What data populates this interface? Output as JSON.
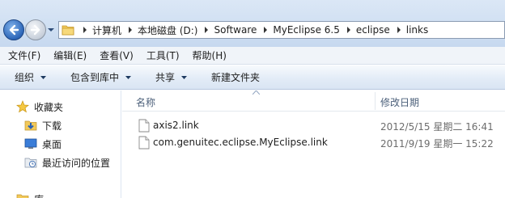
{
  "address_bar": {
    "breadcrumbs": [
      "计算机",
      "本地磁盘 (D:)",
      "Software",
      "MyEclipse 6.5",
      "eclipse",
      "links"
    ],
    "separator_icon": "chevron-right-icon",
    "folder_icon": "folder-icon"
  },
  "menu": {
    "items": [
      "文件(F)",
      "编辑(E)",
      "查看(V)",
      "工具(T)",
      "帮助(H)"
    ]
  },
  "commands": {
    "organize": "组织",
    "include_library": "包含到库中",
    "share": "共享",
    "new_folder": "新建文件夹"
  },
  "nav_pane": {
    "items": [
      {
        "label": "收藏夹",
        "icon": "star-icon"
      },
      {
        "label": "下载",
        "icon": "downloads-folder-icon"
      },
      {
        "label": "桌面",
        "icon": "desktop-icon"
      },
      {
        "label": "最近访问的位置",
        "icon": "recent-places-icon"
      },
      {
        "label": "库",
        "icon": "library-icon"
      }
    ]
  },
  "file_list": {
    "columns": {
      "name": "名称",
      "date_modified": "修改日期"
    },
    "rows": [
      {
        "name": "axis2.link",
        "date": "2012/5/15 星期二 16:41",
        "icon": "file-icon"
      },
      {
        "name": "com.genuitec.eclipse.MyEclipse.link",
        "date": "2011/9/19 星期一 15:22",
        "icon": "file-icon"
      }
    ]
  }
}
